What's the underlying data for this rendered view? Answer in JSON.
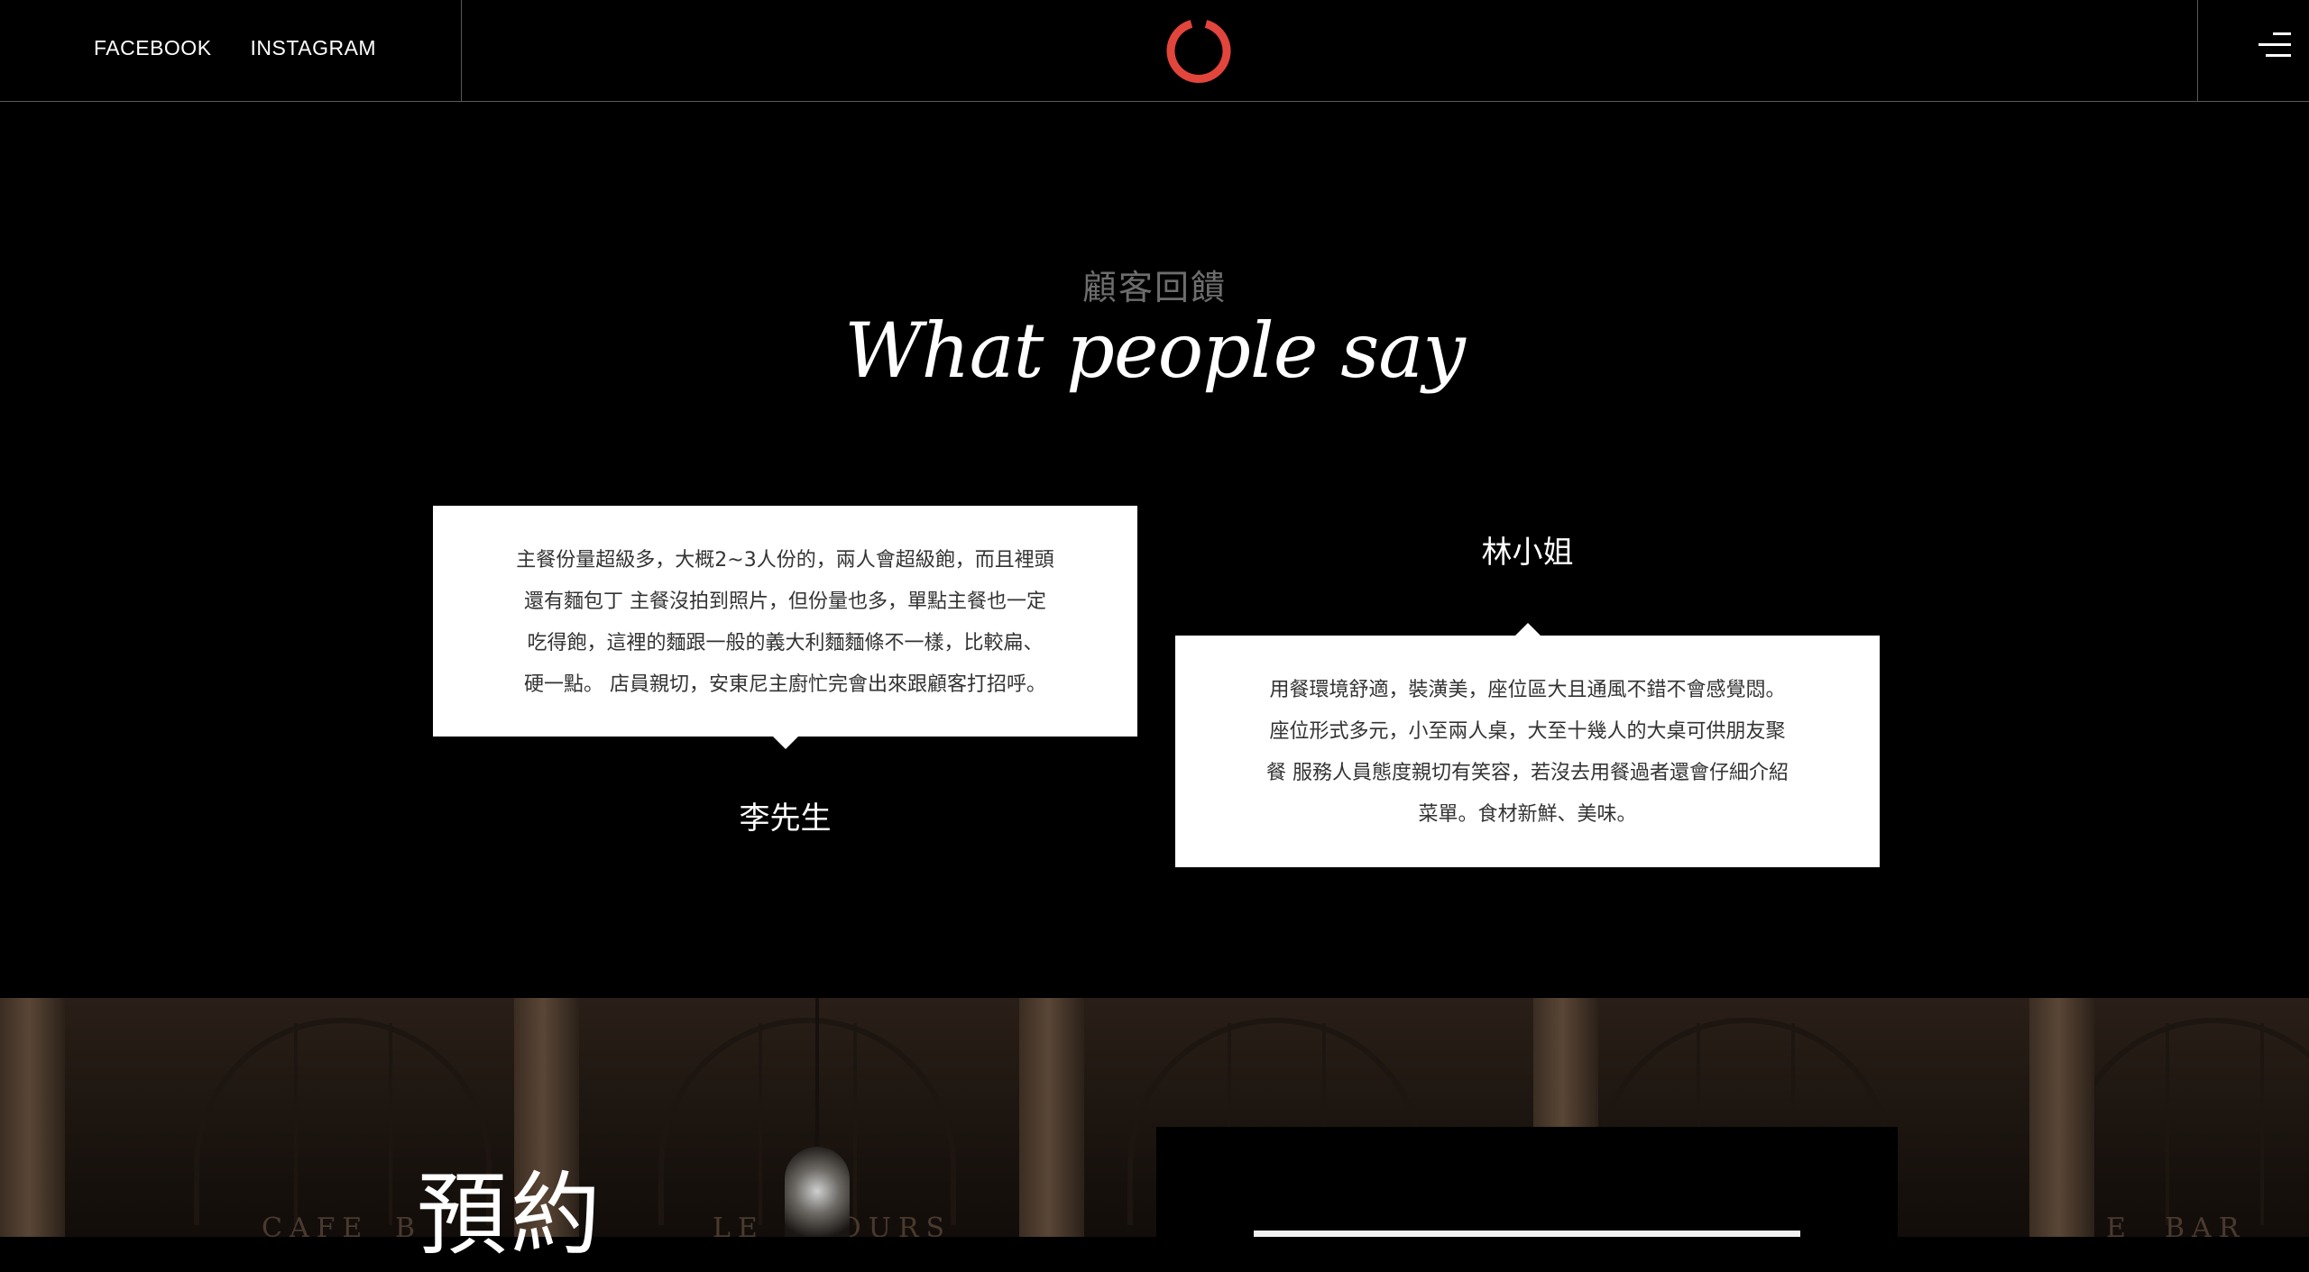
{
  "header": {
    "social_links": [
      "FACEBOOK",
      "INSTAGRAM"
    ],
    "logo_icon": "ring-logo-icon",
    "menu_icon": "hamburger-menu-icon",
    "accent_color": "#e2453c"
  },
  "testimonials": {
    "subtitle": "顧客回饋",
    "title": "What people say",
    "items": [
      {
        "author": "李先生",
        "lines": [
          "主餐份量超級多，大概2~3人份的，兩人會超級飽，而且裡頭",
          "還有麵包丁 主餐沒拍到照片，但份量也多，單點主餐也一定",
          "吃得飽，這裡的麵跟一般的義大利麵麵條不一樣，比較扁、",
          "硬一點。 店員親切，安東尼主廚忙完會出來跟顧客打招呼。"
        ]
      },
      {
        "author": "林小姐",
        "lines": [
          "用餐環境舒適，裝潢美，座位區大且通風不錯不會感覺悶。",
          "座位形式多元，小至兩人桌，大至十幾人的大桌可供朋友聚",
          "餐 服務人員態度親切有笑容，若沒去用餐過者還會仔細介紹",
          "菜單。食材新鮮、美味。"
        ]
      }
    ]
  },
  "reservation": {
    "title": "預約",
    "background_signs": [
      "CAFE",
      "B",
      "LE",
      "OURS",
      "E",
      "BAR"
    ]
  }
}
